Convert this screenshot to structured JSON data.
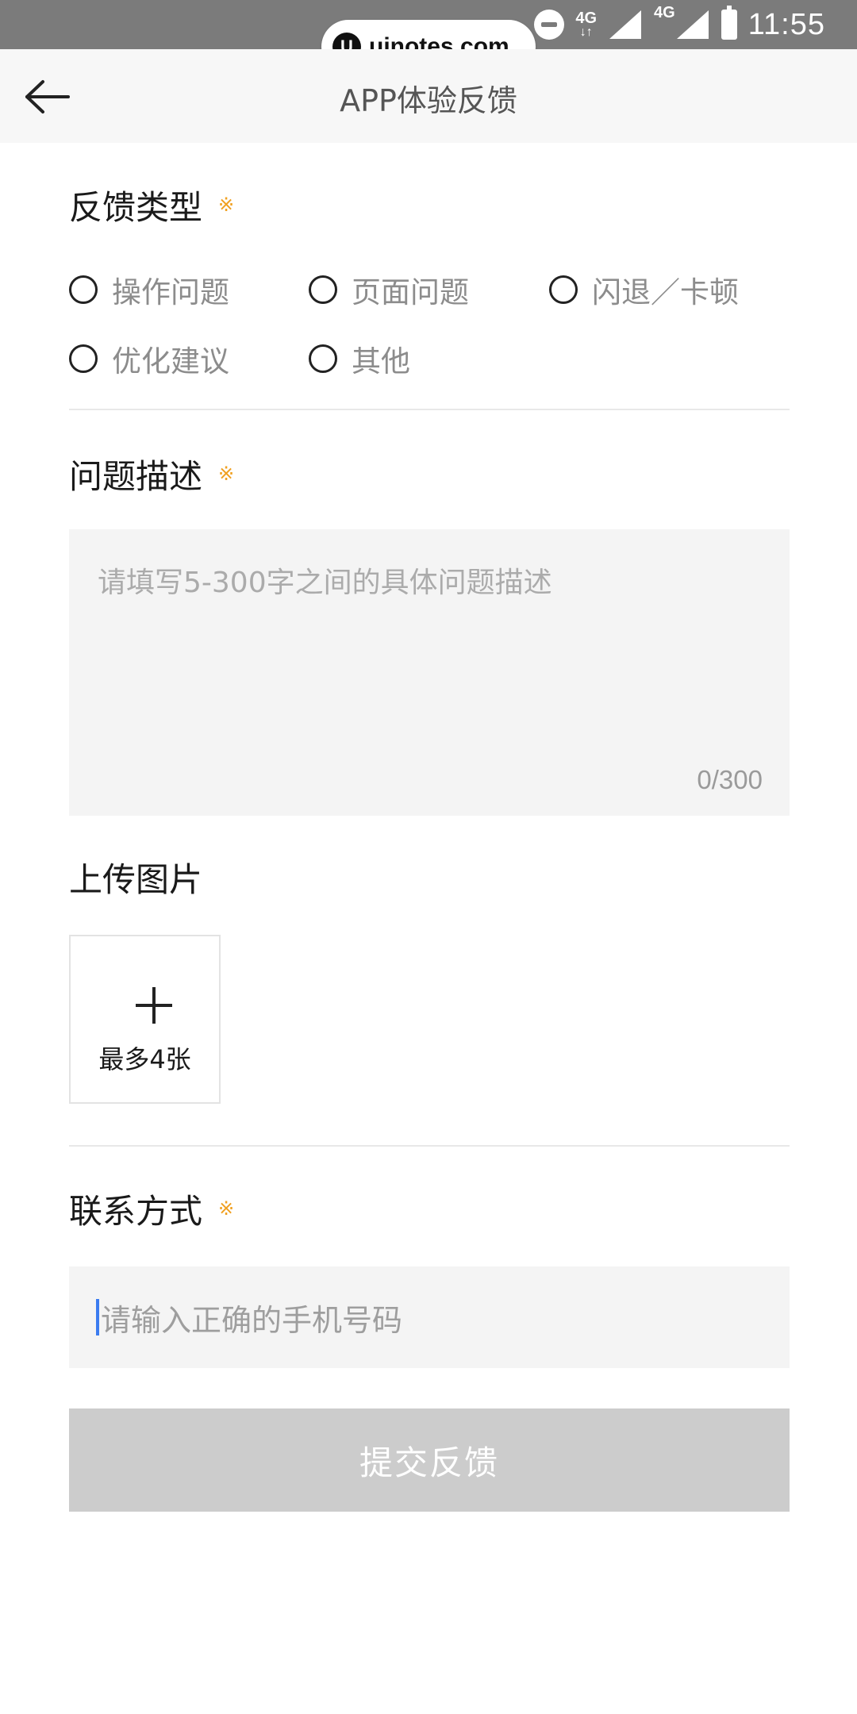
{
  "status_bar": {
    "time": "11:55",
    "network_1": "4G",
    "network_2": "4G",
    "icons": [
      "do-not-disturb-icon",
      "signal-icon",
      "signal-icon",
      "battery-icon"
    ]
  },
  "watermark": {
    "logo": "U",
    "text": "uinotes.com"
  },
  "nav": {
    "back_icon": "arrow-left-icon",
    "title": "APP体验反馈"
  },
  "feedback_type": {
    "title": "反馈类型",
    "required_mark": "※",
    "options": [
      {
        "label": "操作问题",
        "selected": false
      },
      {
        "label": "页面问题",
        "selected": false
      },
      {
        "label": "闪退／卡顿",
        "selected": false
      },
      {
        "label": "优化建议",
        "selected": false
      },
      {
        "label": "其他",
        "selected": false
      }
    ]
  },
  "description": {
    "title": "问题描述",
    "required_mark": "※",
    "placeholder": "请填写5-300字之间的具体问题描述",
    "counter": "0/300"
  },
  "upload": {
    "title": "上传图片",
    "icon": "plus-icon",
    "label": "最多4张"
  },
  "contact": {
    "title": "联系方式",
    "required_mark": "※",
    "placeholder": "请输入正确的手机号码"
  },
  "submit": {
    "label": "提交反馈"
  },
  "colors": {
    "required": "#f0a020",
    "input_bg": "#f4f4f4",
    "button_disabled": "#cccccc",
    "caret": "#3b7cf0"
  }
}
